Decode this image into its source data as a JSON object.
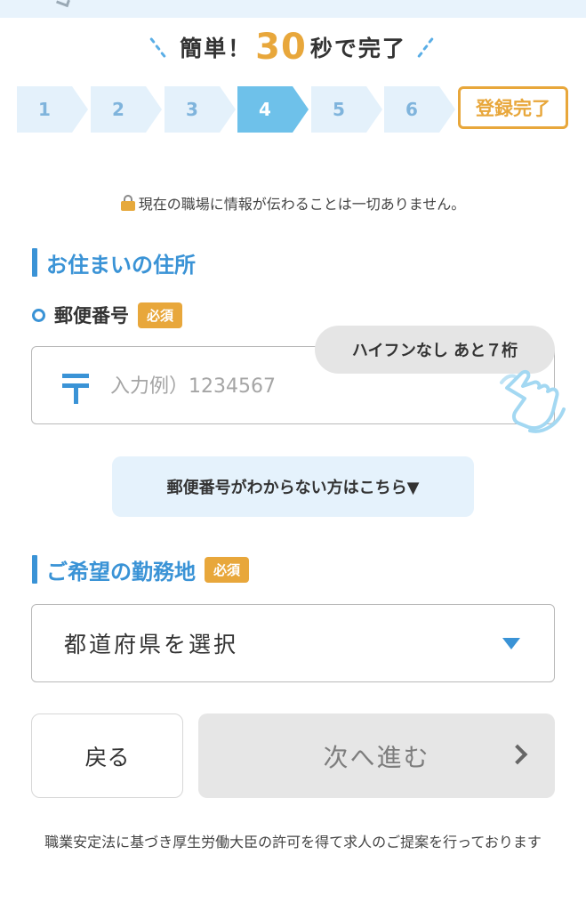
{
  "headline": {
    "prefix": "簡単！",
    "number": "30",
    "suffix": "秒で完了"
  },
  "steps": {
    "items": [
      "1",
      "2",
      "3",
      "4",
      "5",
      "6"
    ],
    "active_index": 4,
    "done_label": "登録完了"
  },
  "privacy_note": "現在の職場に情報が伝わることは一切ありません。",
  "address_section": {
    "title": "お住まいの住所",
    "postal_label": "郵便番号",
    "required_label": "必須",
    "postal_placeholder": "入力例）1234567",
    "postal_value": "",
    "hint": "ハイフンなし あと７桁",
    "zip_help_link": "郵便番号がわからない方はこちら▼"
  },
  "workplace_section": {
    "title": "ご希望の勤務地",
    "required_label": "必須",
    "select_value": "都道府県を選択"
  },
  "nav": {
    "back_label": "戻る",
    "next_label": "次へ進む"
  },
  "footer_note": "職業安定法に基づき厚生労働大臣の許可を得て求人のご提案を行っております",
  "colors": {
    "accent_blue": "#3a93d6",
    "step_active": "#6ec1ea",
    "step_inactive": "#e4f1fb",
    "orange": "#e8a73b",
    "disabled_button": "#e6e6e6"
  },
  "icons": [
    "back-chevron-icon",
    "lock-icon",
    "postal-mark-icon",
    "pointing-hand-icon",
    "caret-down-icon",
    "chevron-right-icon"
  ]
}
